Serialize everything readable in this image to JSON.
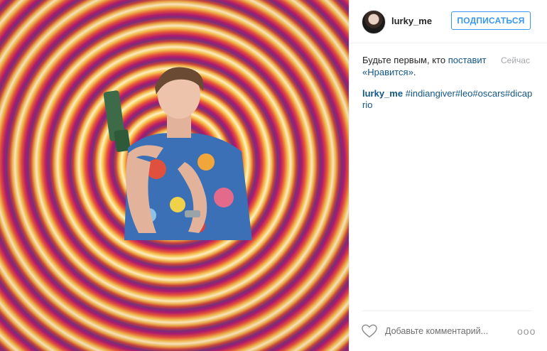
{
  "post": {
    "username": "lurky_me",
    "follow_label": "ПОДПИСАТЬСЯ",
    "likes_prefix": "Будьте первым, кто ",
    "likes_link": "поставит «Нравится»",
    "likes_suffix": ".",
    "timestamp": "Сейчас",
    "caption_user": "lurky_me",
    "caption_tags": "#indiangiver#leo#oscars#dicaprio",
    "comment_placeholder": "Добавьте комментарий...",
    "more_glyph": "ooo"
  },
  "icons": {
    "heart": "heart-icon",
    "more": "more-options-icon",
    "avatar": "avatar"
  },
  "colors": {
    "accent": "#3897f0",
    "link": "#125688",
    "muted": "#a5a7aa"
  }
}
